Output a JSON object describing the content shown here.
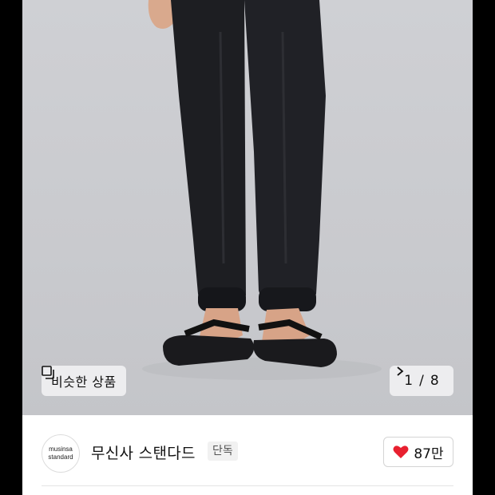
{
  "product_gallery": {
    "similar_button_label": "비슷한 상품",
    "similar_icon": "stack-icon",
    "pager": {
      "current": "1",
      "separator": "/",
      "total": "8",
      "next_icon": "chevron-right-icon"
    }
  },
  "brand": {
    "logo_line1": "musinsa",
    "logo_line2": "standard",
    "name": "무신사 스탠다드",
    "badge": "단독"
  },
  "like": {
    "icon": "heart-icon",
    "color": "#e8202f",
    "count": "87만"
  }
}
